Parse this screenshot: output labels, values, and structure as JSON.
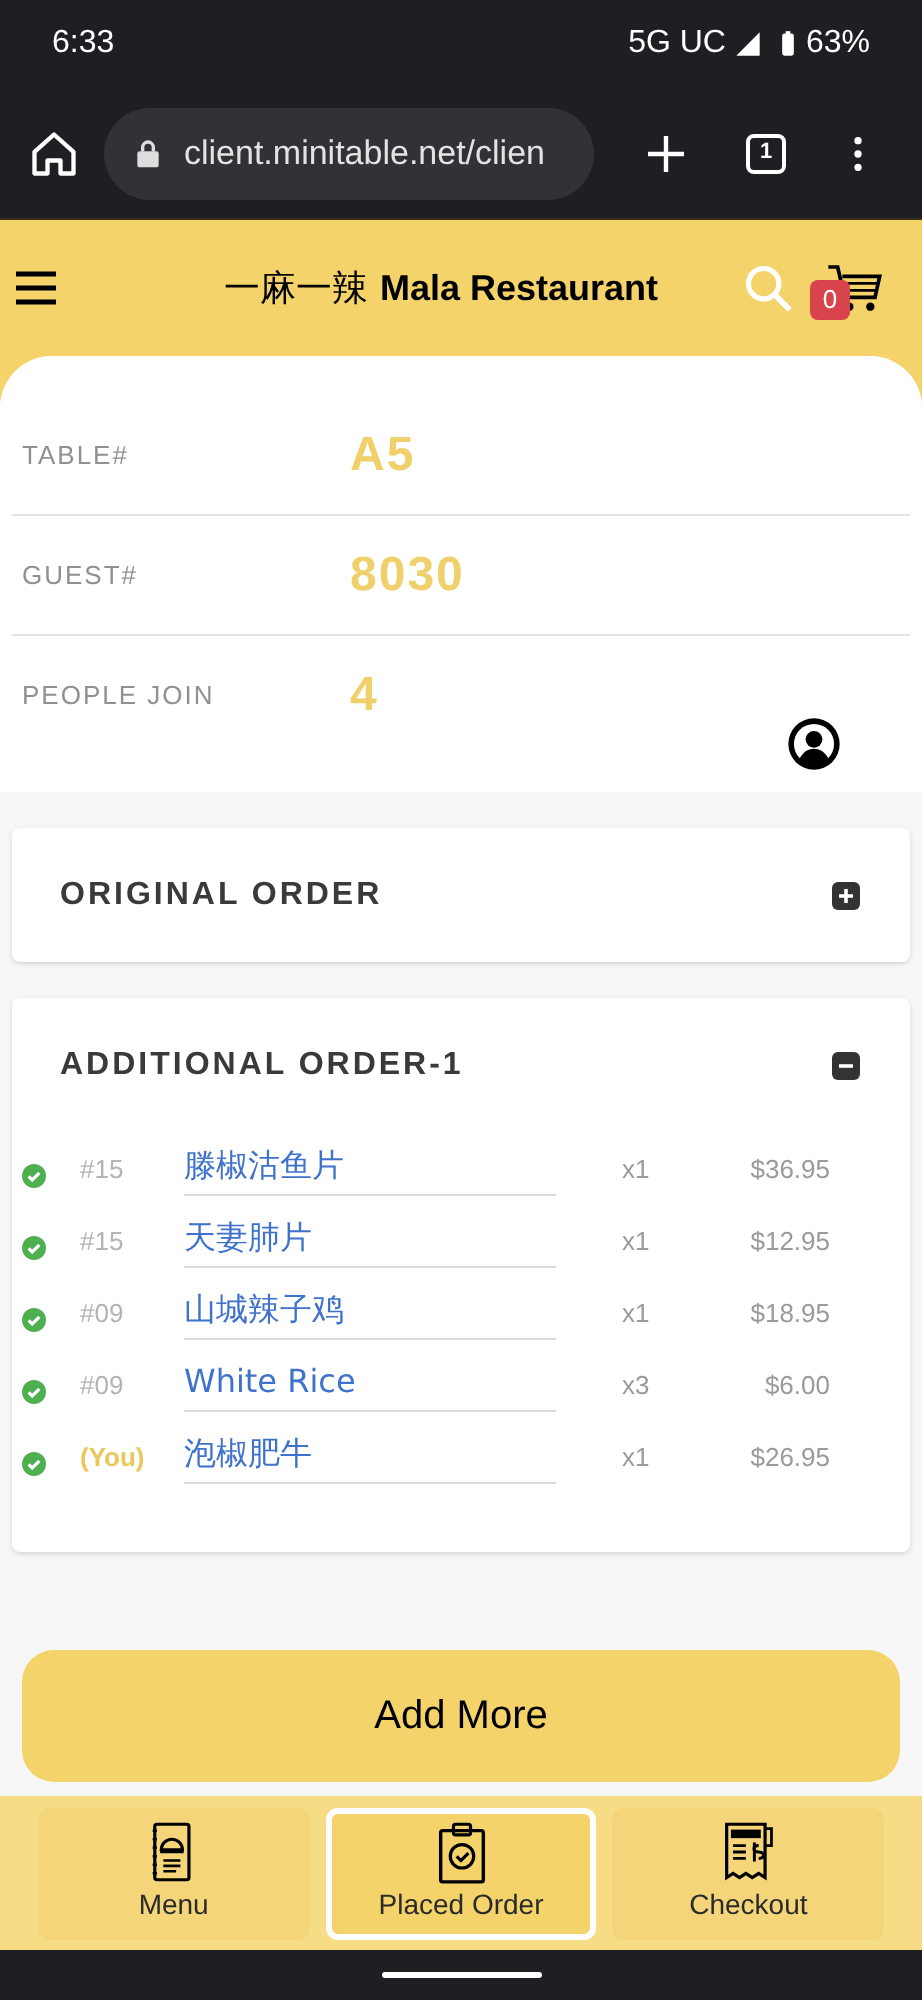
{
  "status_bar": {
    "time": "6:33",
    "network": "5G UC",
    "battery": "63%"
  },
  "browser": {
    "url": "client.minitable.net/clien",
    "tab_count": "1"
  },
  "header": {
    "title_cn": "一麻一辣",
    "title": "Mala Restaurant",
    "cart_count": "0"
  },
  "info": [
    {
      "label": "TABLE#",
      "value": "A5"
    },
    {
      "label": "GUEST#",
      "value": "8030"
    },
    {
      "label": "PEOPLE JOIN",
      "value": "4"
    }
  ],
  "sections": [
    {
      "title": "ORIGINAL ORDER",
      "expanded": false
    },
    {
      "title": "ADDITIONAL ORDER-1",
      "expanded": true,
      "items": [
        {
          "confirmed": true,
          "guest": "#15",
          "mine": false,
          "name": "滕椒沽鱼片",
          "qty": "x1",
          "price": "$36.95"
        },
        {
          "confirmed": true,
          "guest": "#15",
          "mine": false,
          "name": "天妻肺片",
          "qty": "x1",
          "price": "$12.95"
        },
        {
          "confirmed": true,
          "guest": "#09",
          "mine": false,
          "name": "山城辣子鸡",
          "qty": "x1",
          "price": "$18.95"
        },
        {
          "confirmed": true,
          "guest": "#09",
          "mine": false,
          "name": "White Rice",
          "qty": "x3",
          "price": "$6.00"
        },
        {
          "confirmed": true,
          "guest": "(You)",
          "mine": true,
          "name": "泡椒肥牛",
          "qty": "x1",
          "price": "$26.95"
        }
      ]
    }
  ],
  "add_button": "Add More",
  "nav": [
    {
      "label": "Menu",
      "kind": "menu",
      "selected": false
    },
    {
      "label": "Placed Order",
      "kind": "order",
      "selected": true
    },
    {
      "label": "Checkout",
      "kind": "bill",
      "selected": false
    }
  ]
}
